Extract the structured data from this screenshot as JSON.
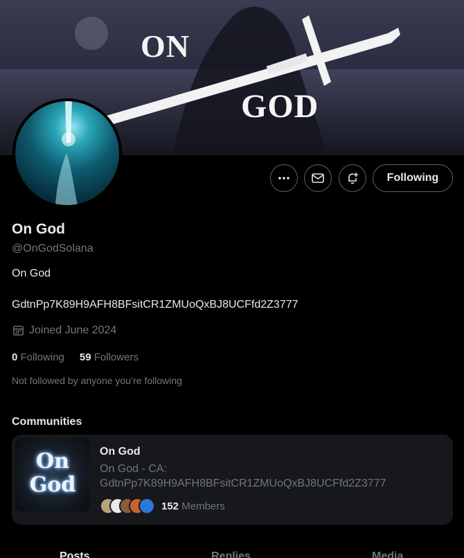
{
  "banner": {
    "word_top": "ON",
    "word_bottom": "GOD"
  },
  "actions": {
    "more_icon": "more-horizontal-icon",
    "message_icon": "envelope-icon",
    "notify_icon": "bell-plus-icon",
    "following_label": "Following"
  },
  "profile": {
    "name": "On God",
    "handle": "@OnGodSolana",
    "bio": "On God",
    "contract": "GdtnPp7K89H9AFH8BFsitCR1ZMUoQxBJ8UCFfd2Z3777",
    "joined": "Joined June 2024",
    "following_count": "0",
    "following_label": "Following",
    "followers_count": "59",
    "followers_label": "Followers",
    "not_followed": "Not followed by anyone you’re following"
  },
  "communities": {
    "heading": "Communities",
    "card": {
      "image_text_top": "On",
      "image_text_bottom": "God",
      "title": "On God",
      "desc_line1": "On God - CA:",
      "desc_line2": "GdtnPp7K89H9AFH8BFsitCR1ZMUoQxBJ8UCFfd2Z3777",
      "member_count": "152",
      "member_label": "Members"
    }
  },
  "tabs": {
    "posts": "Posts",
    "replies": "Replies",
    "media": "Media"
  },
  "colors": {
    "background": "#000000",
    "text": "#e7e9ea",
    "muted": "#71767b",
    "border": "#536471",
    "card": "#16181c"
  }
}
